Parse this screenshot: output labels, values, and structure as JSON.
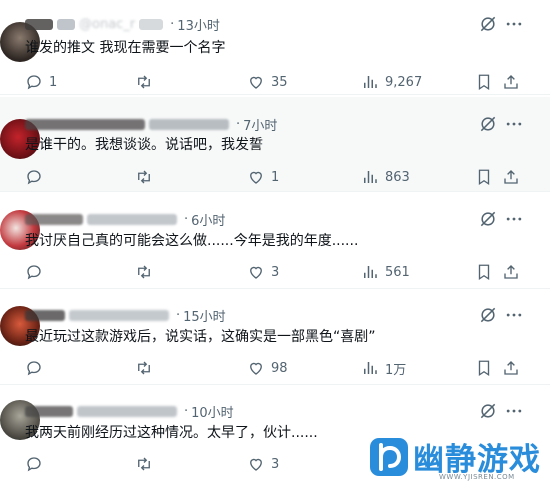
{
  "tweets": [
    {
      "handle": "@onac_r",
      "time": "13小时",
      "text": "谁发的推文 我现在需要一个名字",
      "replies": "1",
      "retweets": "",
      "likes": "35",
      "views": "9,267",
      "highlighted": false
    },
    {
      "handle": "",
      "time": "7小时",
      "text": "是谁干的。我想谈谈。说话吧，我发誓",
      "replies": "",
      "retweets": "",
      "likes": "1",
      "views": "863",
      "highlighted": true
    },
    {
      "handle": "",
      "time": "6小时",
      "text": "我讨厌自己真的可能会这么做......今年是我的年度......",
      "replies": "",
      "retweets": "",
      "likes": "3",
      "views": "561",
      "highlighted": false
    },
    {
      "handle": "",
      "time": "15小时",
      "text": "最近玩过这款游戏后，说实话，这确实是一部黑色“喜剧”",
      "replies": "",
      "retweets": "",
      "likes": "98",
      "views": "1万",
      "highlighted": false
    },
    {
      "handle": "",
      "time": "10小时",
      "text": "我两天前刚经历过这种情况。太早了，伙计......",
      "replies": "",
      "retweets": "",
      "likes": "3",
      "views": "",
      "highlighted": false
    }
  ],
  "separator": "·",
  "watermark": {
    "title": "幽静游戏",
    "url": "WWW.YJISREN.COM"
  },
  "colors": {
    "text": "#0f1419",
    "muted": "#536471",
    "highlight_bg": "#f7f9f9",
    "watermark_blue": "#2a8ddb"
  }
}
